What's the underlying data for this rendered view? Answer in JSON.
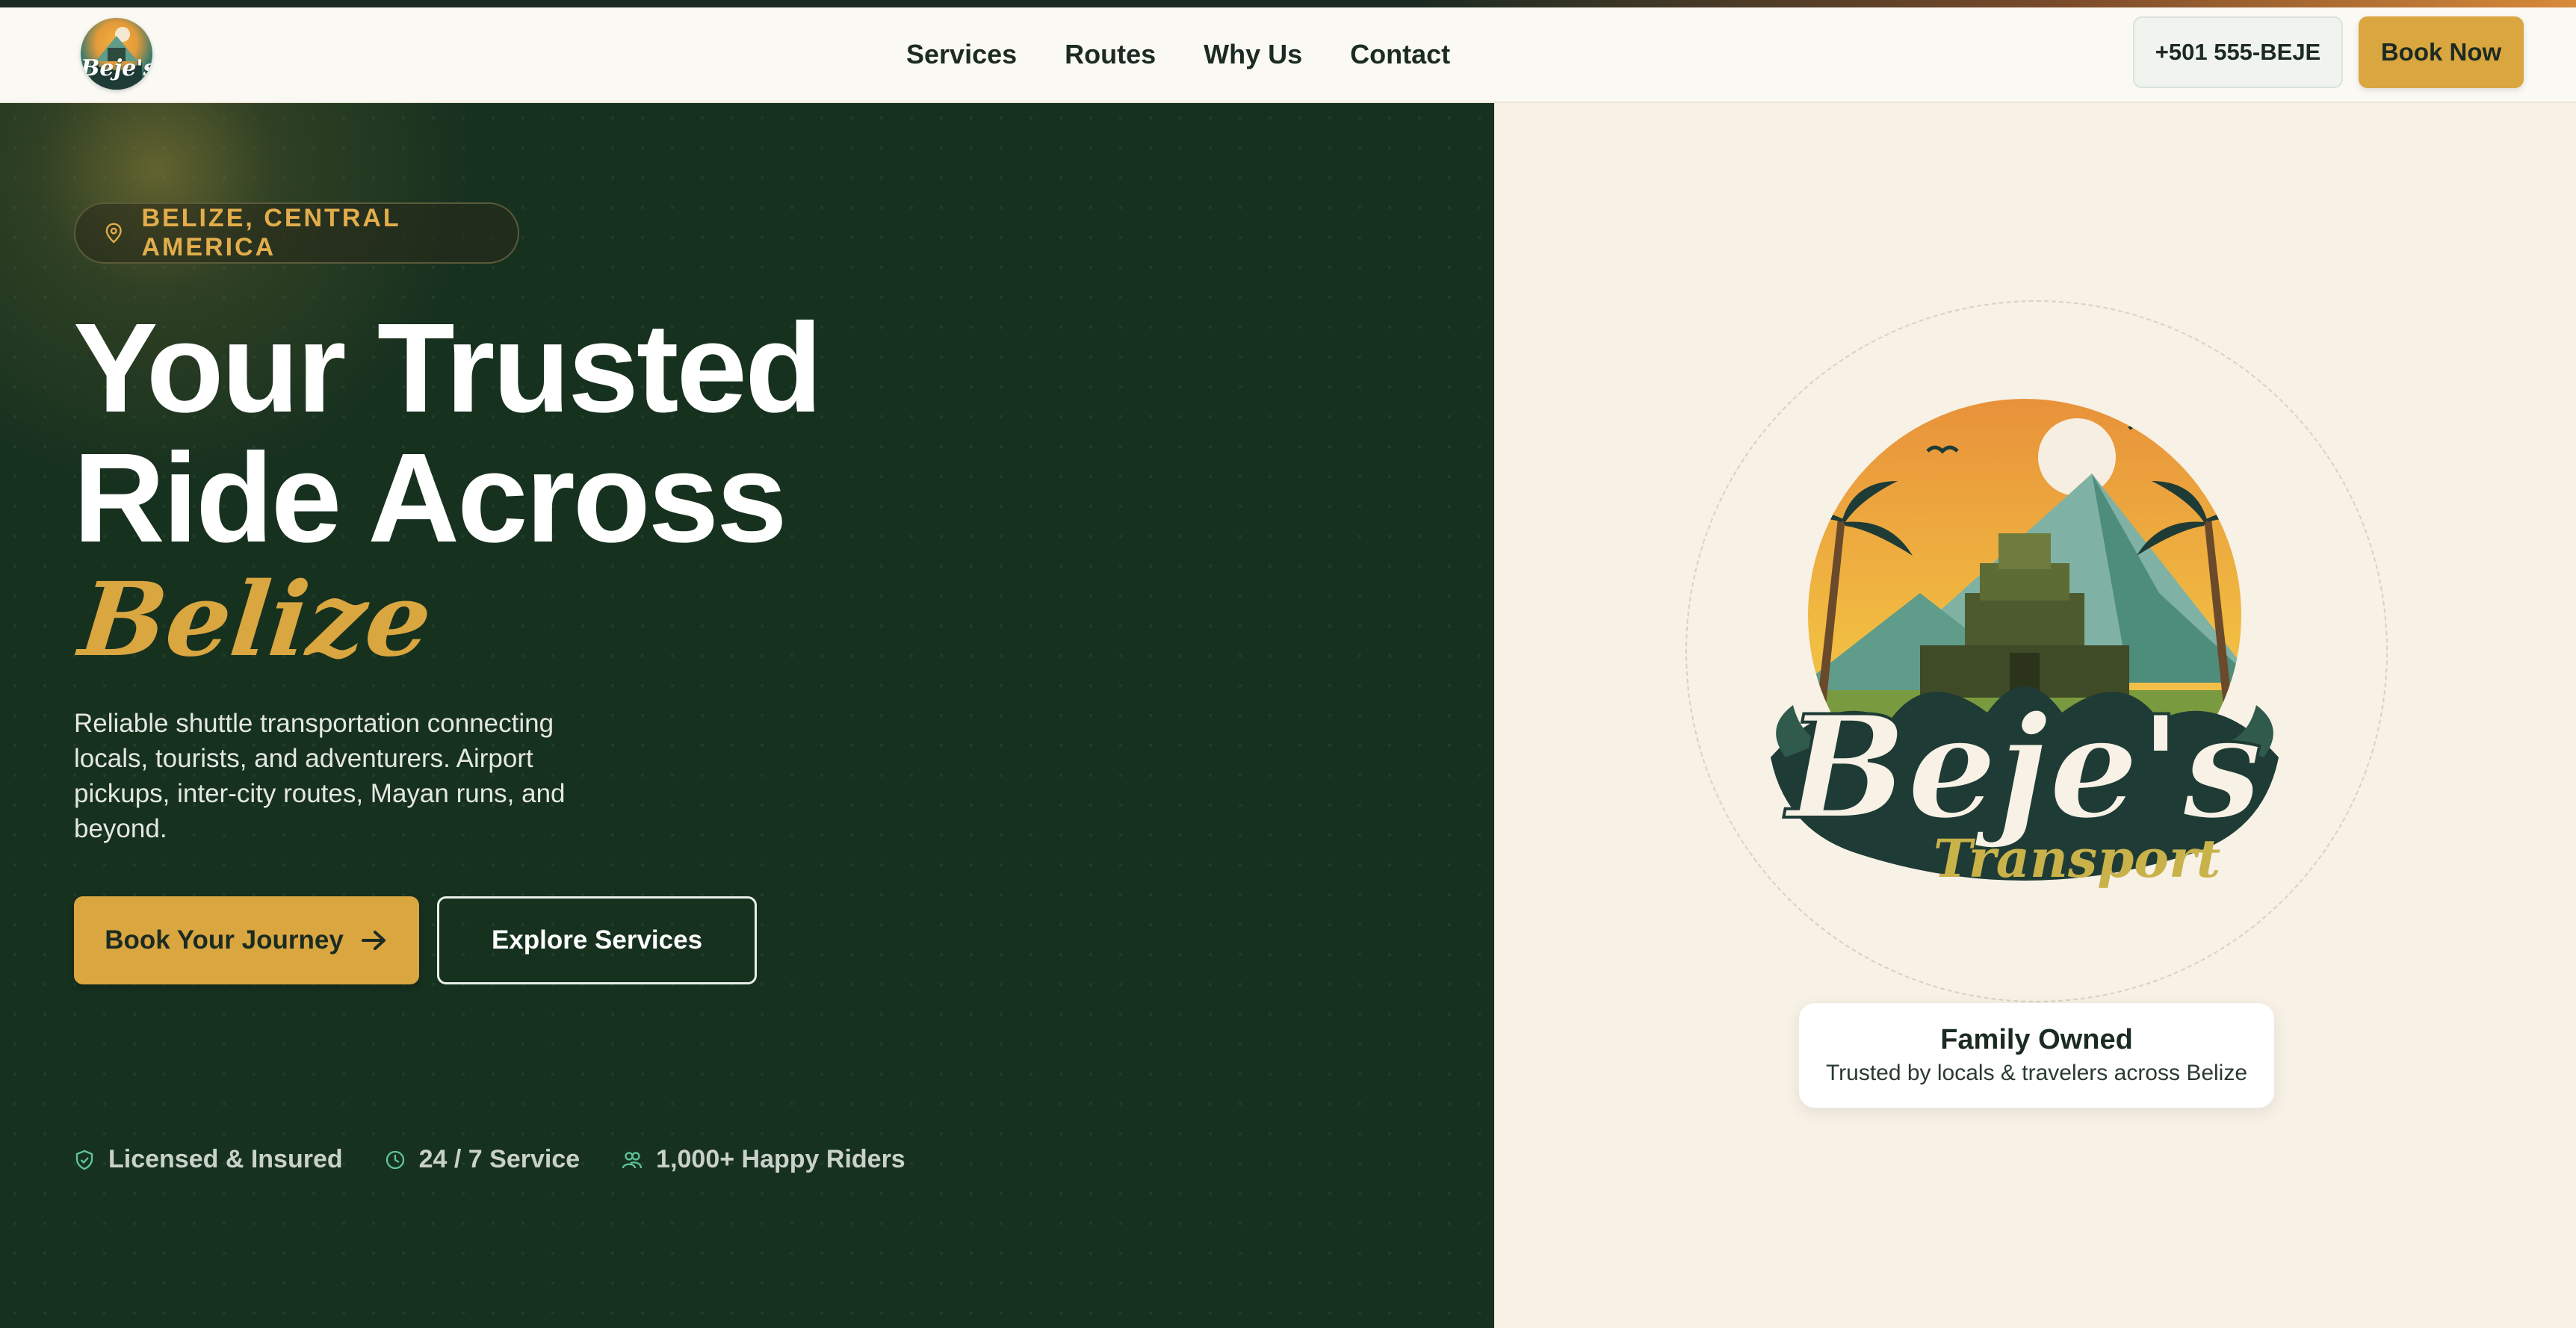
{
  "brand": {
    "logo_text": "Beje's"
  },
  "nav": {
    "links": [
      "Services",
      "Routes",
      "Why Us",
      "Contact"
    ],
    "phone": "+501 555-BEJE",
    "book_now": "Book Now"
  },
  "hero": {
    "location_badge": "BELIZE, CENTRAL AMERICA",
    "headline_line1": "Your Trusted",
    "headline_line2": "Ride Across",
    "headline_script": "Belize",
    "subtext": "Reliable shuttle transportation connecting locals, tourists, and adventurers. Airport pickups, inter-city routes, Mayan runs, and beyond.",
    "cta_primary": "Book Your Journey",
    "cta_secondary": "Explore Services",
    "trust": [
      "Licensed & Insured",
      "24 / 7 Service",
      "1,000+ Happy Riders"
    ]
  },
  "emblem": {
    "name": "Beje's",
    "tagline": "Transport"
  },
  "family_card": {
    "title": "Family Owned",
    "subtitle": "Trusted by locals & travelers across Belize"
  },
  "colors": {
    "dark_green": "#17311f",
    "gold": "#d9a640",
    "cream": "#f7f1e6",
    "ink": "#1c2b22"
  }
}
